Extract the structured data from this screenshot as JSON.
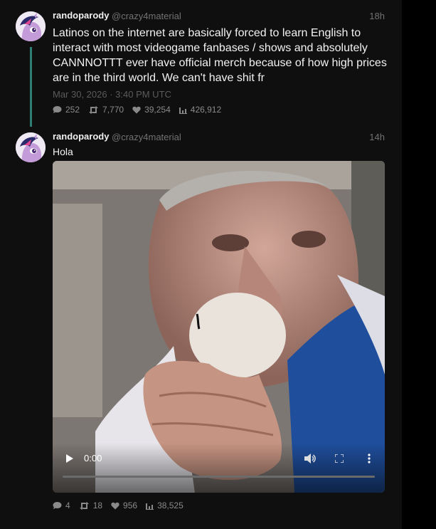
{
  "tweets": [
    {
      "author": "randoparody",
      "handle": "@crazy4material",
      "time": "18h",
      "text": "Latinos on the internet are basically forced to learn English to interact with most videogame fanbases / shows and absolutely CANNNOTTT ever have official merch because of how high prices are in the third world. We can't have shit fr",
      "date": "Mar 30, 2026 · 3:40 PM UTC",
      "stats": {
        "replies": "252",
        "retweets": "7,770",
        "likes": "39,254",
        "views": "426,912"
      }
    },
    {
      "author": "randoparody",
      "handle": "@crazy4material",
      "time": "14h",
      "text": "Hola",
      "video": {
        "current_time": "0:00",
        "progress": 0
      },
      "stats": {
        "replies": "4",
        "retweets": "18",
        "likes": "956",
        "views": "38,525"
      }
    }
  ],
  "icons": {
    "reply": "comment-icon",
    "retweet": "retweet-icon",
    "like": "heart-icon",
    "views": "bar-chart-icon",
    "play": "play-icon",
    "volume": "volume-icon",
    "fullscreen": "fullscreen-icon",
    "more": "more-vertical-icon"
  },
  "colors": {
    "thread_line": "#2f7e73",
    "background": "#0f0f10",
    "muted": "#727272"
  }
}
